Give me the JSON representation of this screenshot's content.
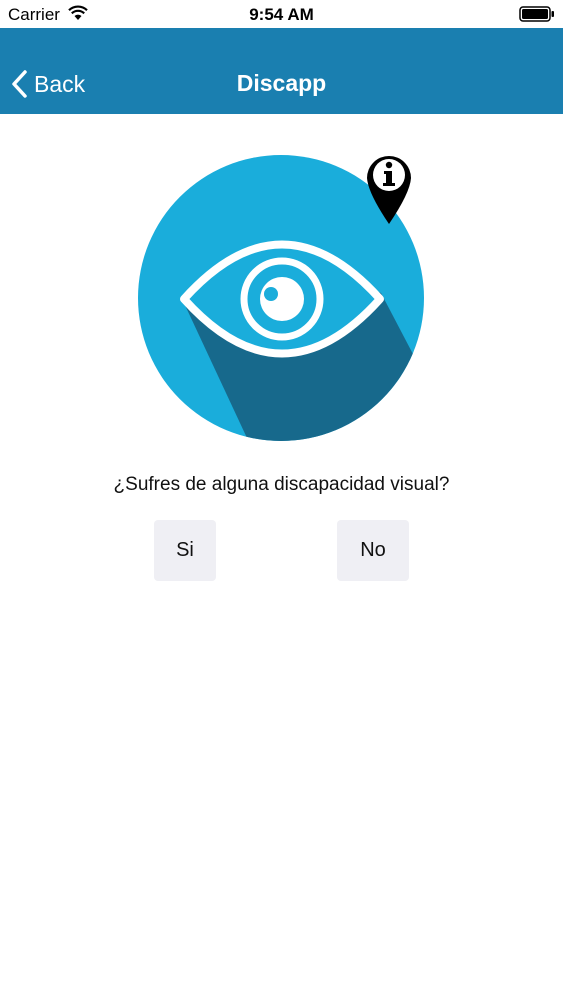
{
  "status_bar": {
    "carrier": "Carrier",
    "time": "9:54 AM"
  },
  "nav": {
    "back_label": "Back",
    "title": "Discapp",
    "background": "#1a7fb0"
  },
  "logo": {
    "circle_color": "#1aaddb",
    "shadow_color": "#17698c",
    "icon": "eye-icon",
    "badge_icon": "info-pin-icon"
  },
  "question": "¿Sufres de alguna discapacidad visual?",
  "buttons": {
    "yes_label": "Si",
    "no_label": "No"
  }
}
